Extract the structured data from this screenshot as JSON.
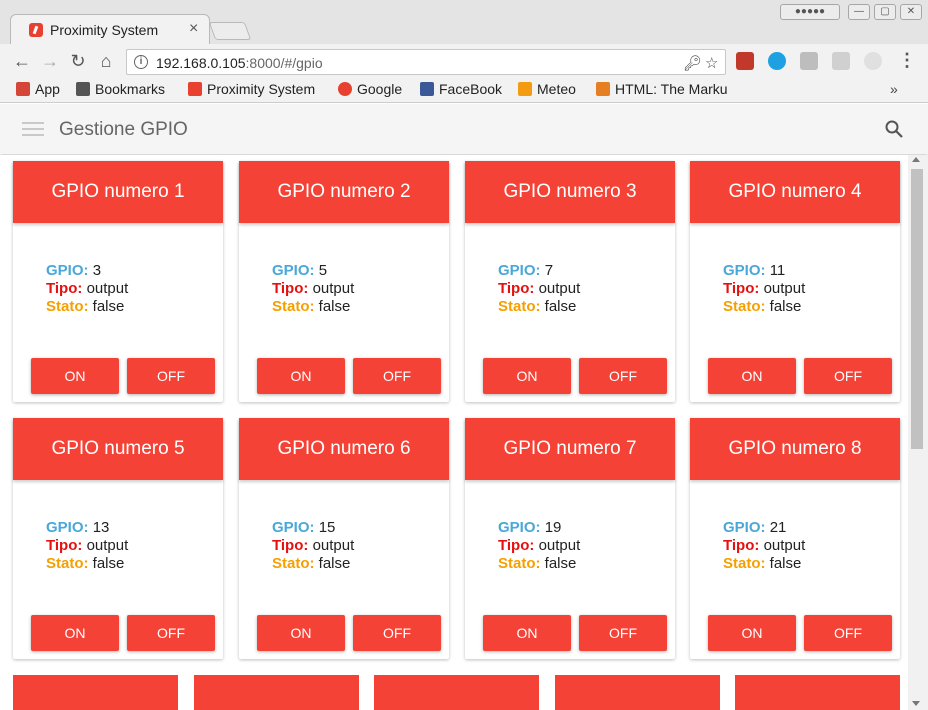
{
  "browser": {
    "tab_title": "Proximity System",
    "tab_close": "×",
    "window_buttons": [
      "●●●●●",
      "—",
      "▢",
      "✕"
    ],
    "url_host": "192.168.0.105",
    "url_rest": ":8000/#/gpio",
    "info_icon": "i",
    "bookmarks": [
      {
        "label": "App",
        "icon": "apps-grid-icon",
        "color": "#d44638"
      },
      {
        "label": "Bookmarks",
        "icon": "star-icon",
        "color": "#555555"
      },
      {
        "label": "Proximity System",
        "icon": "proximity-icon",
        "color": "#e8412f"
      },
      {
        "label": "Google",
        "icon": "google-icon",
        "color": "#e8412f"
      },
      {
        "label": "FaceBook",
        "icon": "facebook-icon",
        "color": "#3b5998"
      },
      {
        "label": "Meteo",
        "icon": "meteo-icon",
        "color": "#f39c12"
      },
      {
        "label": "HTML: The Marku",
        "icon": "w3-icon",
        "color": "#e67e22"
      }
    ],
    "bookmarks_more": "»"
  },
  "app": {
    "title": "Gestione GPIO",
    "accent_color": "#f44336",
    "labels": {
      "gpio": "GPIO:",
      "tipo": "Tipo:",
      "stato": "Stato:"
    },
    "button_on": "ON",
    "button_off": "OFF"
  },
  "cards": [
    {
      "title": "GPIO numero 1",
      "gpio": "3",
      "tipo": "output",
      "stato": "false"
    },
    {
      "title": "GPIO numero 2",
      "gpio": "5",
      "tipo": "output",
      "stato": "false"
    },
    {
      "title": "GPIO numero 3",
      "gpio": "7",
      "tipo": "output",
      "stato": "false"
    },
    {
      "title": "GPIO numero 4",
      "gpio": "11",
      "tipo": "output",
      "stato": "false"
    },
    {
      "title": "GPIO numero 5",
      "gpio": "13",
      "tipo": "output",
      "stato": "false"
    },
    {
      "title": "GPIO numero 6",
      "gpio": "15",
      "tipo": "output",
      "stato": "false"
    },
    {
      "title": "GPIO numero 7",
      "gpio": "19",
      "tipo": "output",
      "stato": "false"
    },
    {
      "title": "GPIO numero 8",
      "gpio": "21",
      "tipo": "output",
      "stato": "false"
    }
  ]
}
